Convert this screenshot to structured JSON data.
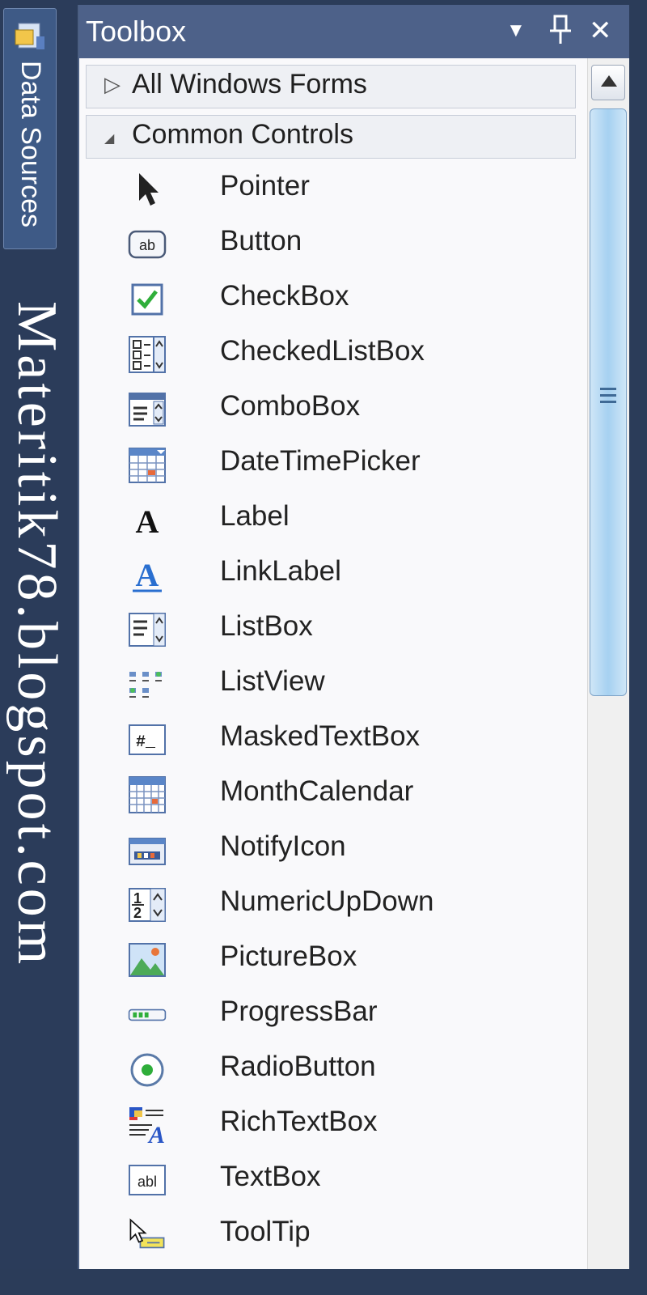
{
  "left_panel": {
    "tab_label": "Data Sources",
    "watermark": "Materitik78.blogspot.com"
  },
  "toolbox": {
    "title": "Toolbox",
    "buttons": {
      "dropdown": "▼",
      "pin": "⊥",
      "close": "✕"
    },
    "groups": [
      {
        "label": "All Windows Forms",
        "expanded": false,
        "arrow": "▷"
      },
      {
        "label": "Common Controls",
        "expanded": true,
        "arrow": "◢"
      }
    ],
    "items": [
      {
        "label": "Pointer",
        "icon": "pointer-icon"
      },
      {
        "label": "Button",
        "icon": "button-icon"
      },
      {
        "label": "CheckBox",
        "icon": "checkbox-icon"
      },
      {
        "label": "CheckedListBox",
        "icon": "checkedlistbox-icon"
      },
      {
        "label": "ComboBox",
        "icon": "combobox-icon"
      },
      {
        "label": "DateTimePicker",
        "icon": "datetimepicker-icon"
      },
      {
        "label": "Label",
        "icon": "label-icon"
      },
      {
        "label": "LinkLabel",
        "icon": "linklabel-icon"
      },
      {
        "label": "ListBox",
        "icon": "listbox-icon"
      },
      {
        "label": "ListView",
        "icon": "listview-icon"
      },
      {
        "label": "MaskedTextBox",
        "icon": "maskedtextbox-icon"
      },
      {
        "label": "MonthCalendar",
        "icon": "monthcalendar-icon"
      },
      {
        "label": "NotifyIcon",
        "icon": "notifyicon-icon"
      },
      {
        "label": "NumericUpDown",
        "icon": "numericupdown-icon"
      },
      {
        "label": "PictureBox",
        "icon": "picturebox-icon"
      },
      {
        "label": "ProgressBar",
        "icon": "progressbar-icon"
      },
      {
        "label": "RadioButton",
        "icon": "radiobutton-icon"
      },
      {
        "label": "RichTextBox",
        "icon": "richtextbox-icon"
      },
      {
        "label": "TextBox",
        "icon": "textbox-icon"
      },
      {
        "label": "ToolTip",
        "icon": "tooltip-icon"
      }
    ],
    "icon_text": {
      "button": "ab",
      "textbox": "abl",
      "masked": "#_",
      "num1": "1",
      "num2": "2",
      "label_a": "A"
    }
  },
  "colors": {
    "titlebar": "#4d6189",
    "background": "#2b3c5a",
    "scroll_thumb": "#a6d1f1",
    "check_green": "#2fae3a",
    "link_blue": "#2a6fd0"
  }
}
